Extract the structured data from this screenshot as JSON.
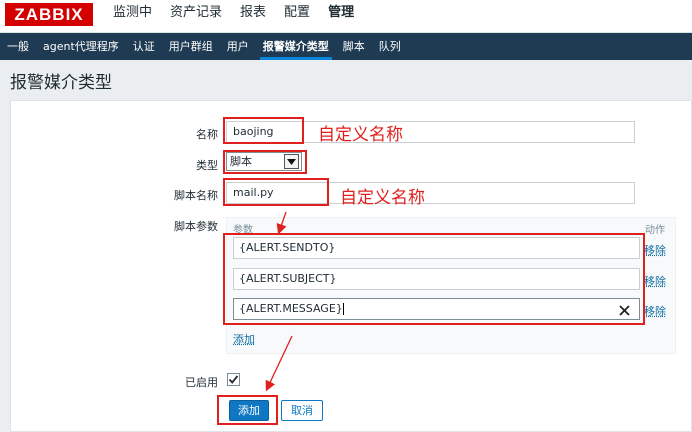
{
  "logo": "ZABBIX",
  "main_menu": [
    {
      "label": "监测中",
      "active": false
    },
    {
      "label": "资产记录",
      "active": false
    },
    {
      "label": "报表",
      "active": false
    },
    {
      "label": "配置",
      "active": false
    },
    {
      "label": "管理",
      "active": true
    }
  ],
  "sub_menu": [
    {
      "label": "一般",
      "active": false
    },
    {
      "label": "agent代理程序",
      "active": false
    },
    {
      "label": "认证",
      "active": false
    },
    {
      "label": "用户群组",
      "active": false
    },
    {
      "label": "用户",
      "active": false
    },
    {
      "label": "报警媒介类型",
      "active": true
    },
    {
      "label": "脚本",
      "active": false
    },
    {
      "label": "队列",
      "active": false
    }
  ],
  "page_title": "报警媒介类型",
  "form": {
    "name_label": "名称",
    "name_value": "baojing",
    "type_label": "类型",
    "type_value": "脚本",
    "script_name_label": "脚本名称",
    "script_name_value": "mail.py",
    "script_params_label": "脚本参数",
    "params_header": "参数",
    "action_header": "动作",
    "params": [
      {
        "value": "{ALERT.SENDTO}",
        "remove": "移除"
      },
      {
        "value": "{ALERT.SUBJECT}",
        "remove": "移除"
      },
      {
        "value": "{ALERT.MESSAGE}",
        "remove": "移除"
      }
    ],
    "add_param_link": "添加",
    "enabled_label": "已启用",
    "enabled_checked": true,
    "submit_button": "添加",
    "cancel_button": "取消"
  },
  "annotations": {
    "custom_name_1": "自定义名称",
    "custom_name_2": "自定义名称"
  },
  "colors": {
    "accent_red": "#e0201e",
    "primary_blue": "#0f78c3",
    "nav_dark": "#1f3b53"
  }
}
